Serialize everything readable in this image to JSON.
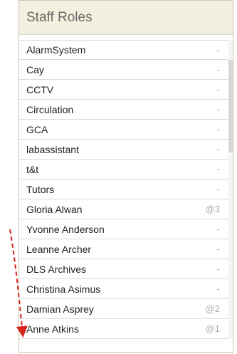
{
  "panel": {
    "title": "Staff Roles"
  },
  "roles": [
    {
      "name": "AlarmSystem",
      "count": "-"
    },
    {
      "name": "Cay",
      "count": "-"
    },
    {
      "name": "CCTV",
      "count": "-"
    },
    {
      "name": "Circulation",
      "count": "-"
    },
    {
      "name": "GCA",
      "count": "-"
    },
    {
      "name": "labassistant",
      "count": "-"
    },
    {
      "name": "t&t",
      "count": "-"
    },
    {
      "name": "Tutors",
      "count": "-"
    },
    {
      "name": "Gloria Alwan",
      "count": "@3"
    },
    {
      "name": "Yvonne Anderson",
      "count": "-"
    },
    {
      "name": "Leanne Archer",
      "count": "-"
    },
    {
      "name": "DLS Archives",
      "count": "-"
    },
    {
      "name": "Christina Asimus",
      "count": "-"
    },
    {
      "name": "Damian Asprey",
      "count": "@2"
    },
    {
      "name": "Anne Atkins",
      "count": "@1"
    }
  ],
  "colors": {
    "annotation_arrow": "#d9241b"
  }
}
